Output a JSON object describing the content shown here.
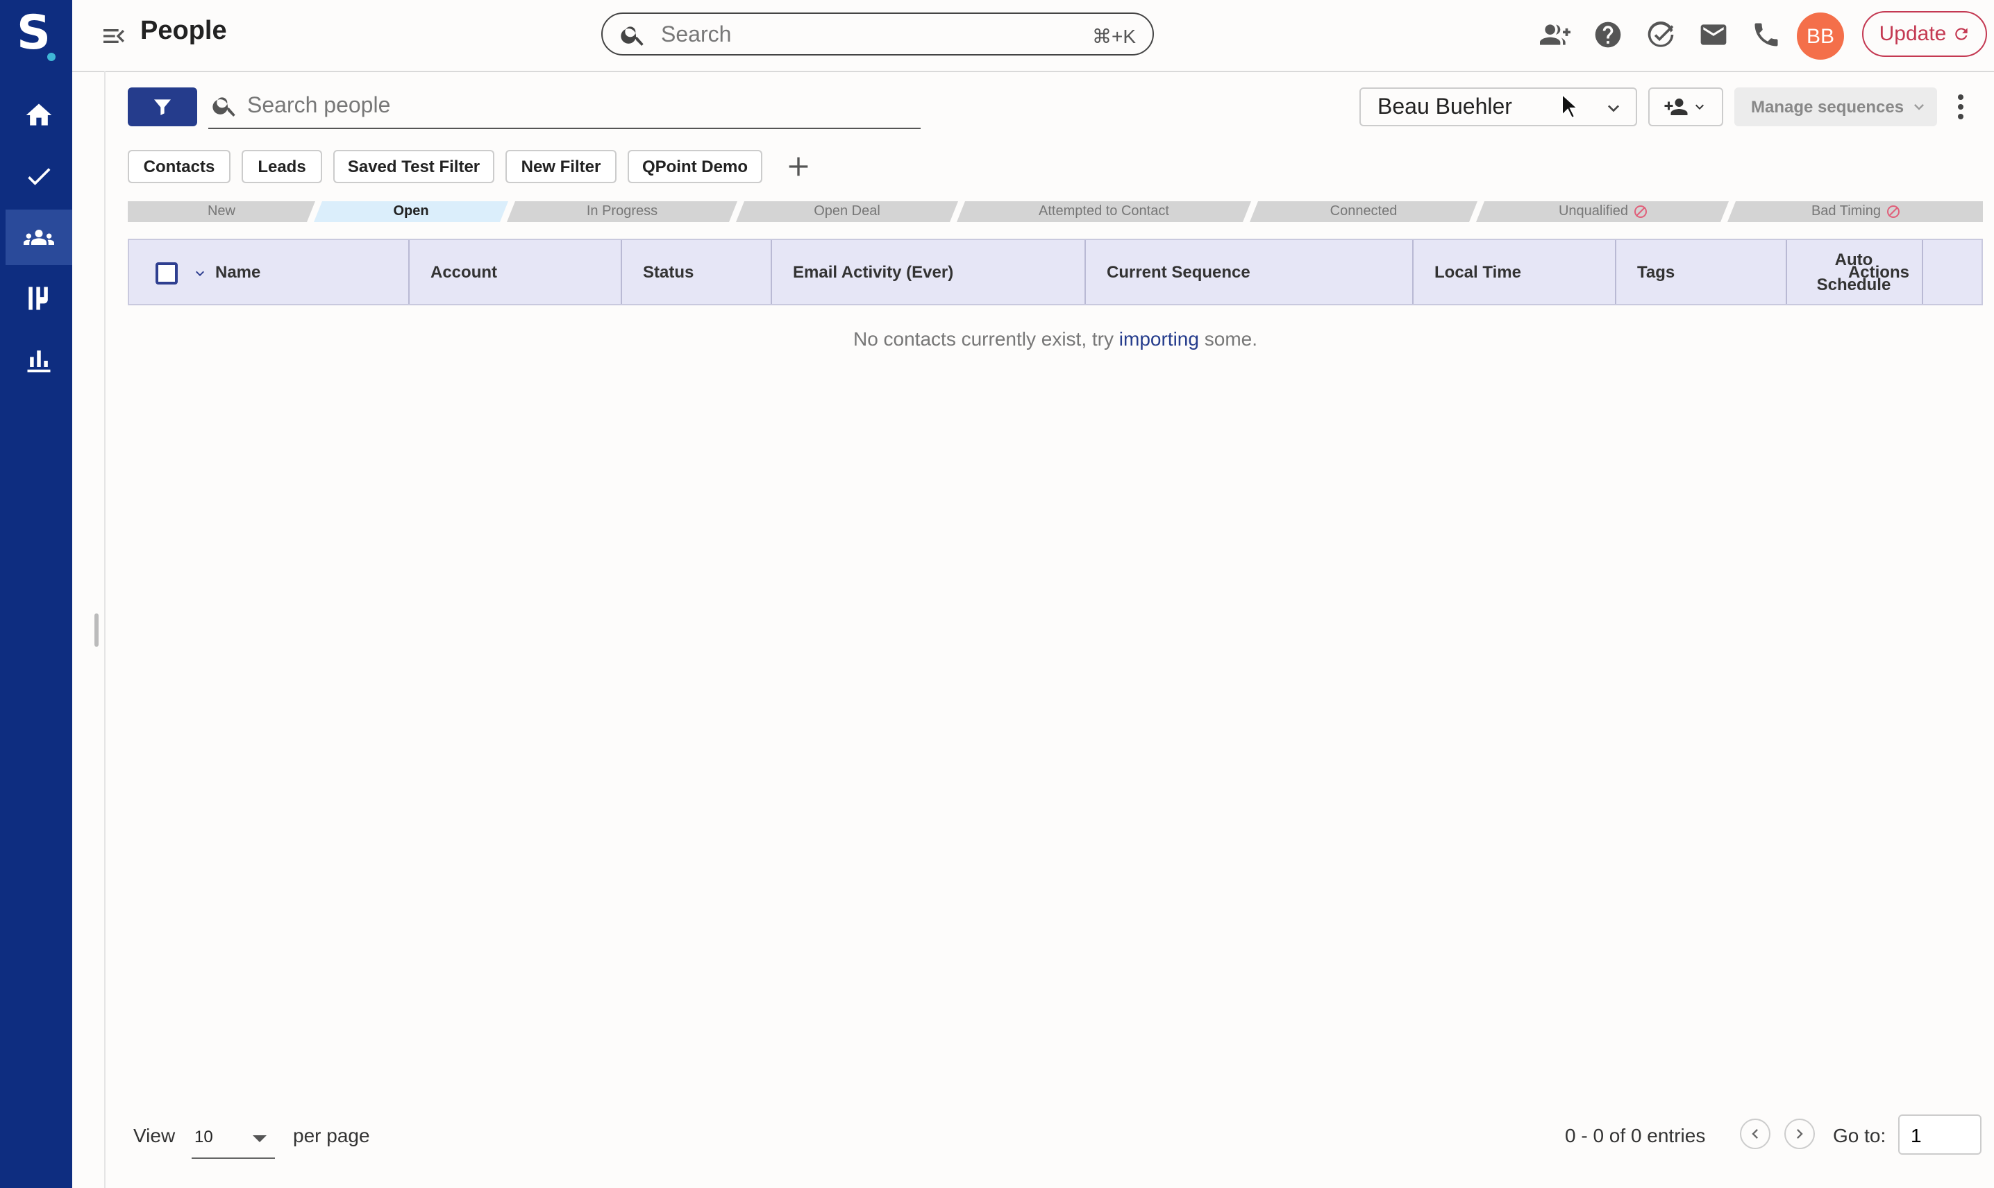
{
  "header": {
    "page_title": "People",
    "search": {
      "placeholder": "Search",
      "shortcut": "⌘+K"
    },
    "avatar_initials": "BB",
    "update_label": "Update"
  },
  "toolbar": {
    "search_placeholder": "Search people",
    "owner": "Beau Buehler",
    "manage_label": "Manage sequences"
  },
  "filters": [
    "Contacts",
    "Leads",
    "Saved Test Filter",
    "New Filter",
    "QPoint Demo"
  ],
  "stages": [
    {
      "label": "New",
      "active": false
    },
    {
      "label": "Open",
      "active": true
    },
    {
      "label": "In Progress",
      "active": false
    },
    {
      "label": "Open Deal",
      "active": false
    },
    {
      "label": "Attempted to Contact",
      "active": false
    },
    {
      "label": "Connected",
      "active": false
    },
    {
      "label": "Unqualified",
      "active": false
    },
    {
      "label": "Bad Timing",
      "active": false
    }
  ],
  "table": {
    "columns": [
      "Name",
      "Account",
      "Status",
      "Email Activity (Ever)",
      "Current Sequence",
      "Local Time",
      "Tags",
      "Auto Schedule",
      "Actions"
    ],
    "empty": {
      "before": "No contacts currently exist, try ",
      "link": "importing",
      "after": " some."
    }
  },
  "footer": {
    "view_label": "View",
    "per_page_value": "10",
    "per_page_label": "per page",
    "entries": "0 - 0 of 0 entries",
    "goto_label": "Go to:",
    "goto_value": "1"
  },
  "colors": {
    "sidebar": "#0e2d80",
    "accent": "#253c8c",
    "avatar": "#f46f4a",
    "update": "#c43952",
    "header_row": "#e6e6f6"
  }
}
